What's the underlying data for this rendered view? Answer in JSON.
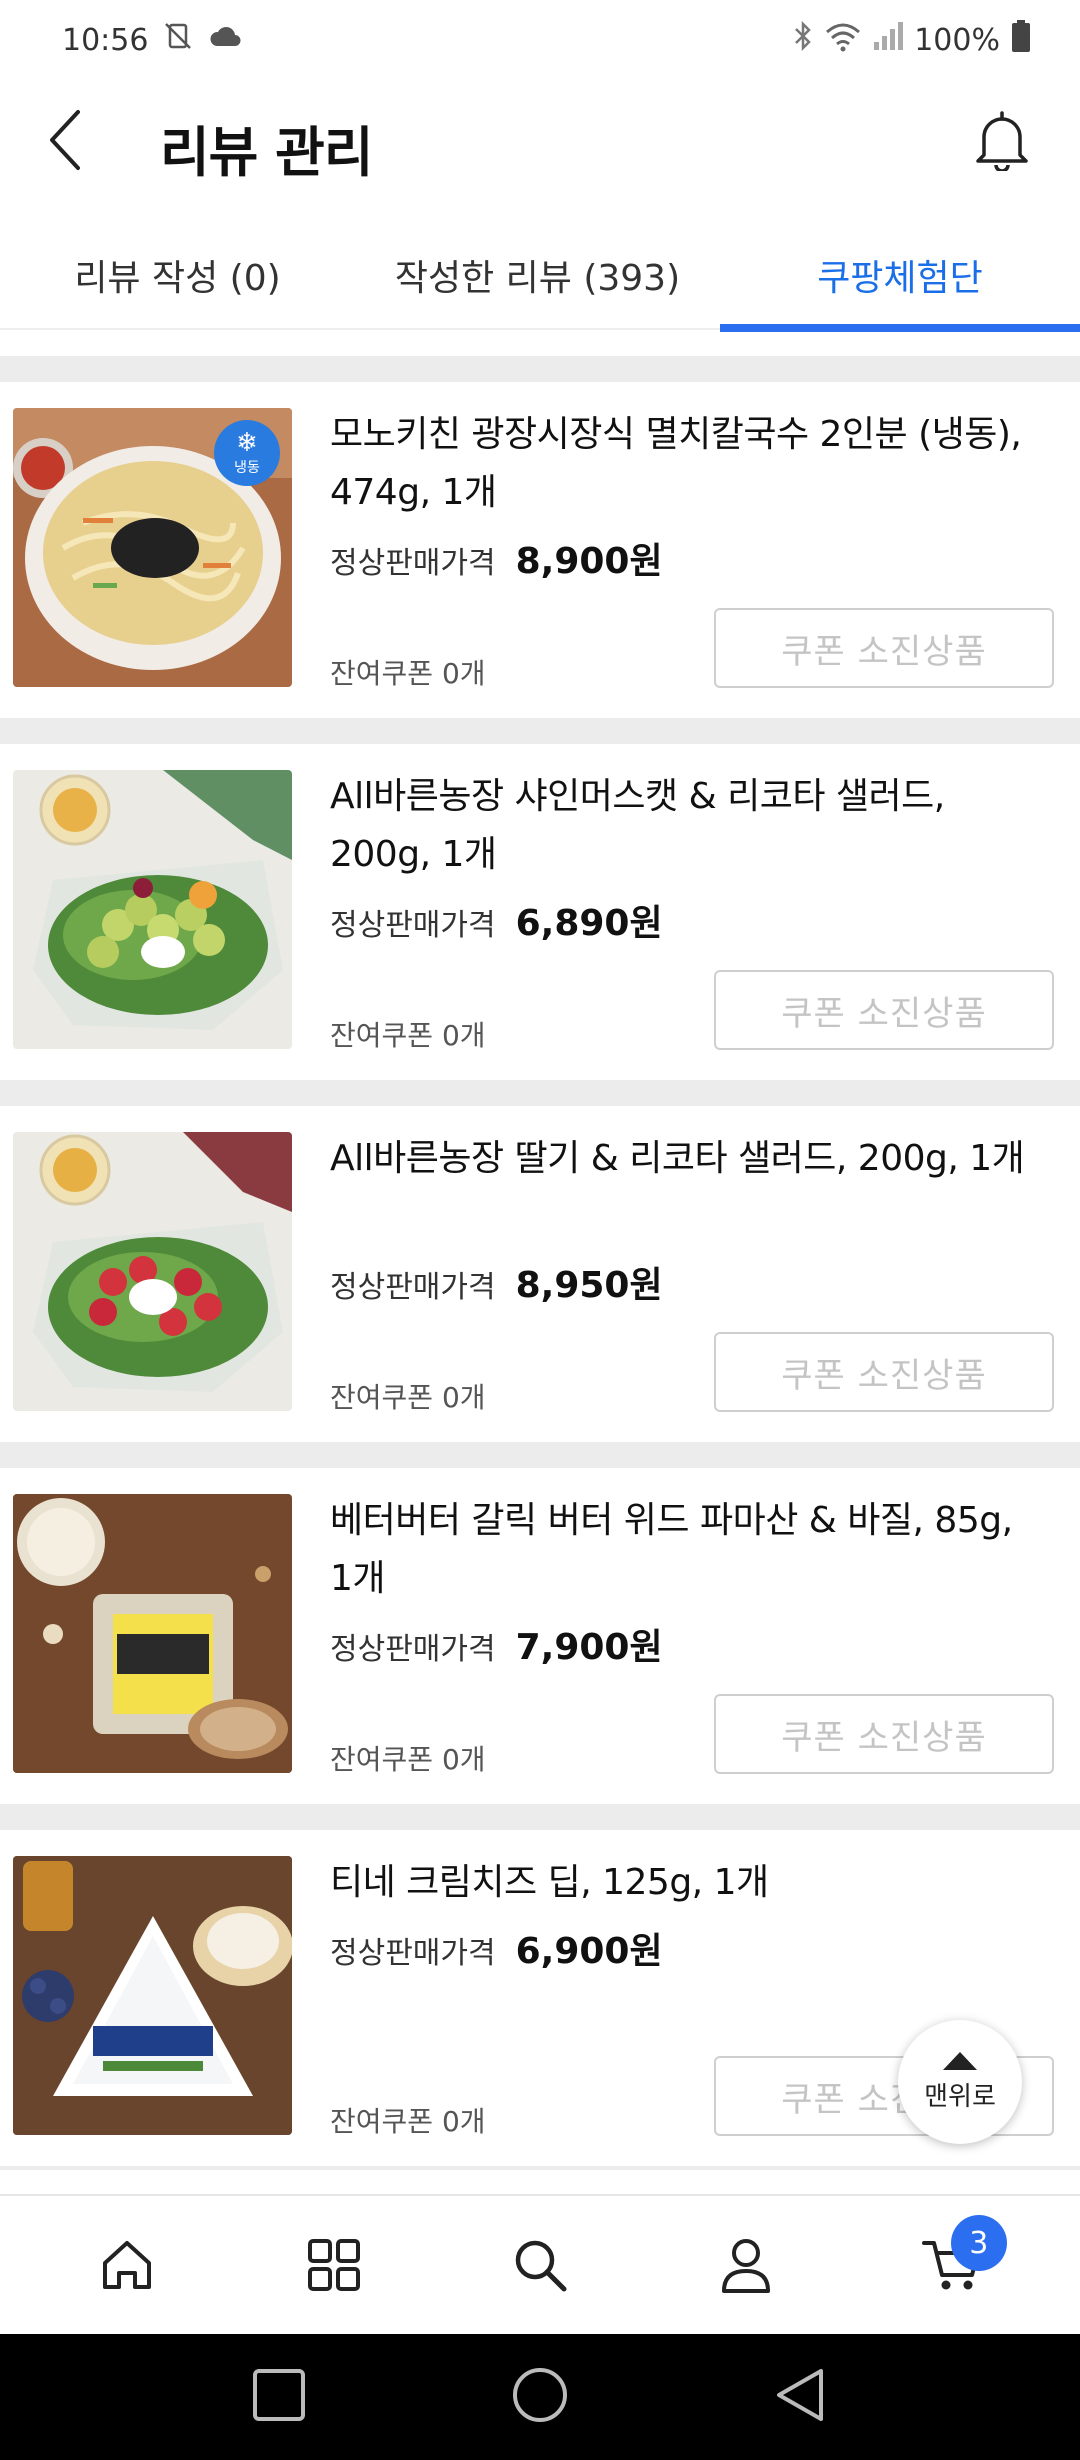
{
  "status_bar": {
    "time": "10:56",
    "battery": "100%"
  },
  "header": {
    "title": "리뷰 관리"
  },
  "tabs": [
    {
      "label": "리뷰 작성 (0)",
      "active": false
    },
    {
      "label": "작성한 리뷰 (393)",
      "active": false
    },
    {
      "label": "쿠팡체험단",
      "active": true
    }
  ],
  "products": [
    {
      "name": "모노키친 광장시장식 멸치칼국수 2인분 (냉동), 474g, 1개",
      "price_label": "정상판매가격",
      "price": "8,900원",
      "coupon": "잔여쿠폰 0개",
      "button": "쿠폰 소진상품",
      "badge": "냉동"
    },
    {
      "name": "All바른농장 샤인머스캣 & 리코타 샐러드, 200g, 1개",
      "price_label": "정상판매가격",
      "price": "6,890원",
      "coupon": "잔여쿠폰 0개",
      "button": "쿠폰 소진상품"
    },
    {
      "name": "All바른농장 딸기 & 리코타 샐러드, 200g, 1개",
      "price_label": "정상판매가격",
      "price": "8,950원",
      "coupon": "잔여쿠폰 0개",
      "button": "쿠폰 소진상품"
    },
    {
      "name": "베터버터 갈릭 버터 위드 파마산 & 바질, 85g, 1개",
      "price_label": "정상판매가격",
      "price": "7,900원",
      "coupon": "잔여쿠폰 0개",
      "button": "쿠폰 소진상품"
    },
    {
      "name": "티네 크림치즈 딥, 125g, 1개",
      "price_label": "정상판매가격",
      "price": "6,900원",
      "coupon": "잔여쿠폰 0개",
      "button": "쿠폰 소진상품"
    }
  ],
  "scroll_top": {
    "label": "맨위로"
  },
  "bottom_nav": {
    "items": [
      {
        "icon": "home-icon"
      },
      {
        "icon": "category-grid-icon"
      },
      {
        "icon": "search-icon"
      },
      {
        "icon": "user-icon"
      },
      {
        "icon": "cart-icon"
      }
    ],
    "cart_count": "3"
  },
  "colors": {
    "accent": "#2b6ff0",
    "divider": "#ececec"
  }
}
